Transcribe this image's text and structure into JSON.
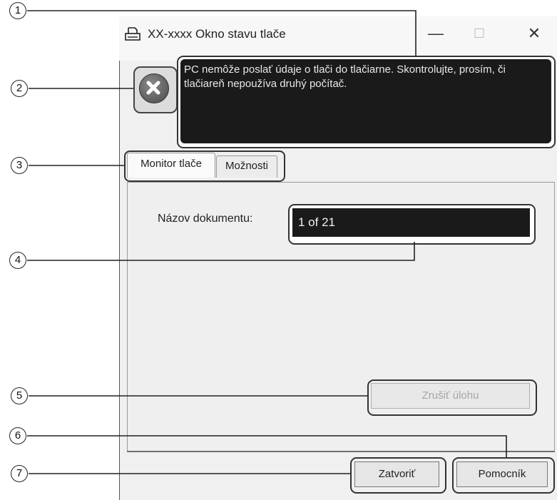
{
  "window": {
    "title": "XX-xxxx Okno stavu tlače",
    "minimize_glyph": "—",
    "maximize_glyph": "☐",
    "close_glyph": "✕"
  },
  "status": {
    "icon": "error-x-icon",
    "message": "PC nemôže poslať údaje o tlači do tlačiarne. Skontrolujte, prosím, či tlačiareň nepoužíva druhý počítač."
  },
  "tabs": [
    {
      "label": "Monitor tlače",
      "selected": true
    },
    {
      "label": "Možnosti",
      "selected": false
    }
  ],
  "monitor": {
    "document_label": "Názov dokumentu:",
    "document_value": "1 of 21",
    "cancel_job_label": "Zrušiť úlohu",
    "cancel_job_enabled": false
  },
  "buttons": {
    "close_label": "Zatvoriť",
    "help_label": "Pomocník"
  },
  "callouts": [
    "1",
    "2",
    "3",
    "4",
    "5",
    "6",
    "7"
  ],
  "colors": {
    "message_bg": "#1a1a1a",
    "message_text": "#e8e8e8",
    "window_bg": "#f0f0f0"
  }
}
